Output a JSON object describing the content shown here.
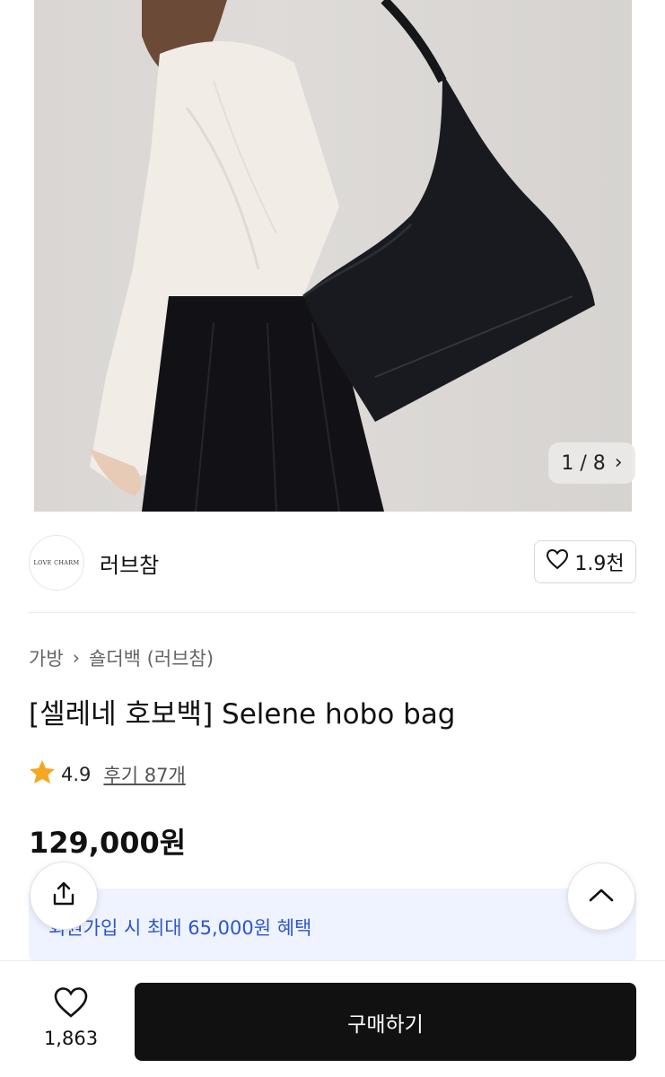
{
  "gallery": {
    "counter": "1 / 8",
    "next_icon": "chevron-right-icon"
  },
  "brand": {
    "logo_text": "LOVE CHARM",
    "name": "러브참",
    "like_count": "1.9천",
    "like_icon": "heart-outline-icon"
  },
  "breadcrumb": {
    "items": [
      "가방",
      "숄더백 (러브참)"
    ],
    "separator_icon": "chevron-right-icon"
  },
  "product": {
    "title": "[셀레네 호보백] Selene hobo bag",
    "rating": "4.9",
    "review_link": "후기 87개",
    "price": "129,000원",
    "star_color": "#f5a623"
  },
  "benefit": {
    "text": "회원가입 시 최대 65,000원 혜택"
  },
  "actions": {
    "share_icon": "share-icon",
    "scroll_top_icon": "chevron-up-icon"
  },
  "bottom_bar": {
    "wish_count": "1,863",
    "buy_label": "구매하기"
  },
  "colors": {
    "buy_button_bg": "#111111",
    "benefit_text": "#2f55c9",
    "benefit_bg": "#eef3ff"
  }
}
